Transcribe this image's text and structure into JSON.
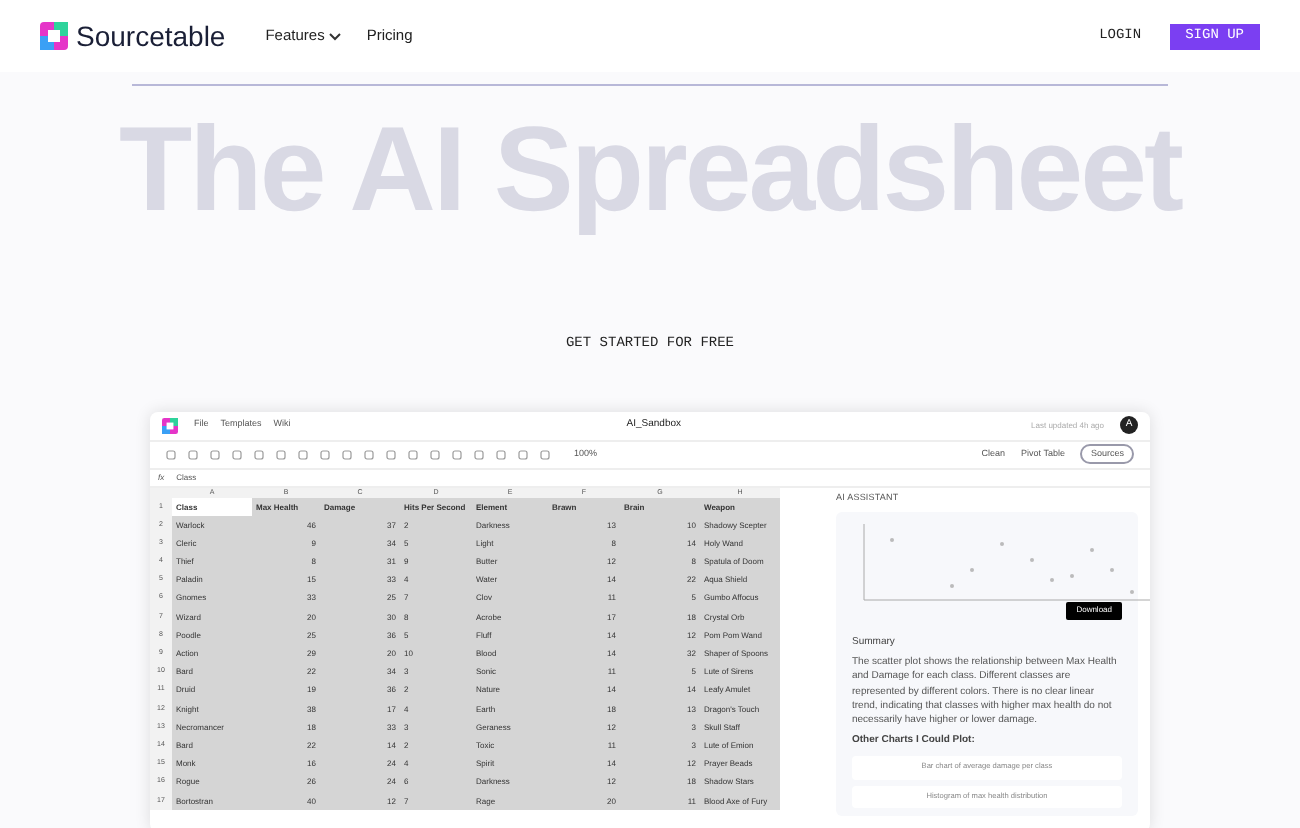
{
  "nav": {
    "brand": "Sourcetable",
    "links": [
      {
        "label": "Features",
        "dropdown": true
      },
      {
        "label": "Pricing",
        "dropdown": false
      }
    ],
    "login": "LOGIN",
    "signup": "SIGN UP"
  },
  "hero": {
    "title": "The AI Spreadsheet",
    "cta": "GET STARTED FOR FREE"
  },
  "app": {
    "menus": [
      "File",
      "Templates",
      "Wiki"
    ],
    "doc_title": "AI_Sandbox",
    "last_saved": "Last updated 4h ago",
    "avatar": "A",
    "zoom": "100%",
    "actions": [
      "Clean",
      "Pivot Table"
    ],
    "sources": "Sources",
    "function_label": "fx",
    "formula": "Class",
    "row_numbers": [
      "1",
      "2",
      "3",
      "4",
      "5",
      "6",
      "7",
      "8",
      "9",
      "10",
      "11",
      "12",
      "13",
      "14",
      "15",
      "16",
      "17"
    ],
    "columns": [
      "A",
      "B",
      "C",
      "D",
      "E",
      "F",
      "G",
      "H"
    ],
    "rows": [
      [
        "Class",
        "Max Health",
        "Damage",
        "Hits Per Second",
        "Element",
        "Brawn",
        "Brain",
        "Weapon"
      ],
      [
        "Warlock",
        "46",
        "37",
        "2",
        "Darkness",
        "13",
        "10",
        "Shadowy Scepter"
      ],
      [
        "Cleric",
        "9",
        "34",
        "5",
        "Light",
        "8",
        "14",
        "Holy Wand"
      ],
      [
        "Thief",
        "8",
        "31",
        "9",
        "Butter",
        "12",
        "8",
        "Spatula of Doom"
      ],
      [
        "Paladin",
        "15",
        "33",
        "4",
        "Water",
        "14",
        "22",
        "Aqua Shield"
      ],
      [
        "Gnomes",
        "33",
        "25",
        "7",
        "Clov",
        "11",
        "5",
        "Gumbo Affocus"
      ],
      [
        "Wizard",
        "20",
        "30",
        "8",
        "Acrobe",
        "17",
        "18",
        "Crystal Orb"
      ],
      [
        "Poodle",
        "25",
        "36",
        "5",
        "Fluff",
        "14",
        "12",
        "Pom Pom Wand"
      ],
      [
        "Action",
        "29",
        "20",
        "10",
        "Blood",
        "14",
        "32",
        "Shaper of Spoons"
      ],
      [
        "Bard",
        "22",
        "34",
        "3",
        "Sonic",
        "11",
        "5",
        "Lute of Sirens"
      ],
      [
        "Druid",
        "19",
        "36",
        "2",
        "Nature",
        "14",
        "14",
        "Leafy Amulet"
      ],
      [
        "Knight",
        "38",
        "17",
        "4",
        "Earth",
        "18",
        "13",
        "Dragon's Touch"
      ],
      [
        "Necromancer",
        "18",
        "33",
        "3",
        "Geraness",
        "12",
        "3",
        "Skull Staff"
      ],
      [
        "Bard",
        "22",
        "14",
        "2",
        "Toxic",
        "11",
        "3",
        "Lute of Emion"
      ],
      [
        "Monk",
        "16",
        "24",
        "4",
        "Spirit",
        "14",
        "12",
        "Prayer Beads"
      ],
      [
        "Rogue",
        "26",
        "24",
        "6",
        "Darkness",
        "12",
        "18",
        "Shadow Stars"
      ],
      [
        "Bortostran",
        "40",
        "12",
        "7",
        "Rage",
        "20",
        "11",
        "Blood Axe of Fury"
      ]
    ],
    "assistant": {
      "title": "AI ASSISTANT",
      "download": "Download",
      "summary_title": "Summary",
      "summary": "The scatter plot shows the relationship between Max Health and Damage for each class. Different classes are represented by different colors. There is no clear linear trend, indicating that classes with higher max health do not necessarily have higher or lower damage.",
      "other_title": "Other Charts I Could Plot:",
      "suggestions": [
        "Bar chart of average damage per class",
        "Histogram of max health distribution"
      ]
    }
  }
}
